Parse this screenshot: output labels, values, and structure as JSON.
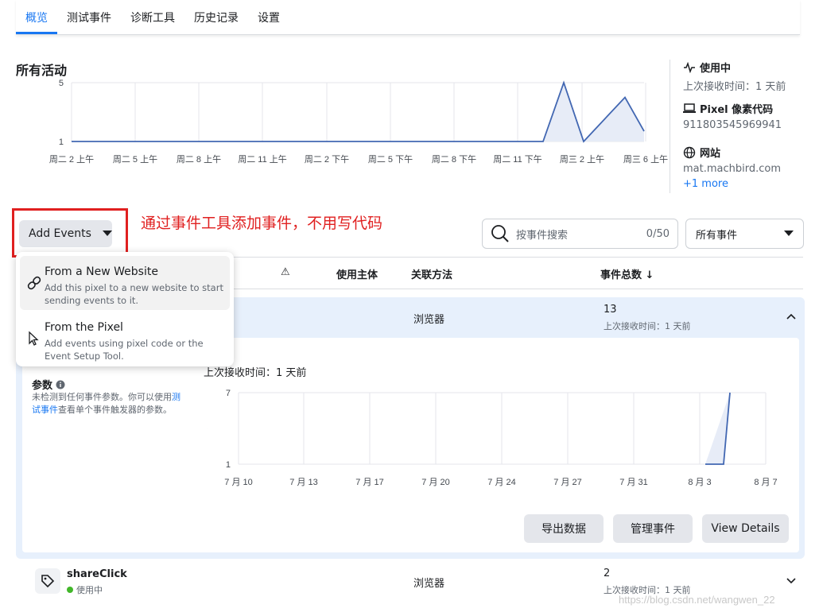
{
  "tabs": [
    {
      "label": "概览",
      "active": true
    },
    {
      "label": "测试事件",
      "active": false
    },
    {
      "label": "诊断工具",
      "active": false
    },
    {
      "label": "历史记录",
      "active": false
    },
    {
      "label": "设置",
      "active": false
    }
  ],
  "overview": {
    "title": "所有活动",
    "chart_data": {
      "type": "area",
      "y_ticks": [
        "5",
        "1"
      ],
      "x": [
        "周二 2 上午",
        "周二 5 上午",
        "周二 8 上午",
        "周二 11 上午",
        "周二 2 下午",
        "周二 5 下午",
        "周二 8 下午",
        "周二 11 下午",
        "周三 2 上午",
        "周三 6 上午"
      ],
      "series": [
        {
          "values": [
            1,
            1,
            1,
            1,
            1,
            1,
            1,
            1,
            5,
            1,
            4,
            1.7
          ]
        }
      ],
      "ylim": [
        1,
        5
      ],
      "grid": true,
      "color": "#4267b2"
    }
  },
  "side_panel": {
    "status_title": "使用中",
    "status_sub": "上次接收时间：1 天前",
    "pixel_title": "Pixel 像素代码",
    "pixel_id": "911803545969941",
    "website_title": "网站",
    "website_url": "mat.machbird.com",
    "more_link": "+1 more"
  },
  "toolbar": {
    "add_events_label": "Add Events",
    "annotation": "通过事件工具添加事件，不用写代码",
    "search_placeholder": "按事件搜索",
    "search_count": "0/50",
    "filter_value": "所有事件"
  },
  "dropdown": {
    "items": [
      {
        "title": "From a New Website",
        "desc": "Add this pixel to a new website to start sending events to it."
      },
      {
        "title": "From the Pixel",
        "desc": "Add events using pixel code or the Event Setup Tool."
      }
    ]
  },
  "table": {
    "headers": {
      "warn": "⚠",
      "entity": "使用主体",
      "method": "关联方法",
      "total": "事件总数 ↓"
    },
    "row1": {
      "method": "浏览器",
      "count": "13",
      "received": "上次接收时间：1 天前"
    },
    "row2": {
      "name": "shareClick",
      "status": "使用中",
      "method": "浏览器",
      "count": "2",
      "received": "上次接收时间：1 天前"
    }
  },
  "details": {
    "params_title": "参数",
    "params_text_before": "未检测到任何事件参数。你可以使用",
    "params_link": "测试事件",
    "params_text_after": "查看单个事件触发器的参数。",
    "received": "上次接收时间：1 天前",
    "chart_data": {
      "type": "area",
      "y_ticks": [
        "7",
        "1"
      ],
      "x": [
        "7 月 10",
        "7 月 13",
        "7 月 17",
        "7 月 20",
        "7 月 24",
        "7 月 27",
        "7 月 31",
        "8 月 3",
        "8 月 7"
      ],
      "series": [
        {
          "values": [
            1,
            1,
            1,
            7,
            4
          ]
        }
      ],
      "ylim": [
        1,
        7
      ],
      "grid": true,
      "color": "#4267b2"
    },
    "buttons": {
      "export": "导出数据",
      "manage": "管理事件",
      "view": "View Details"
    }
  },
  "watermark": "https://blog.csdn.net/wangwen_22"
}
